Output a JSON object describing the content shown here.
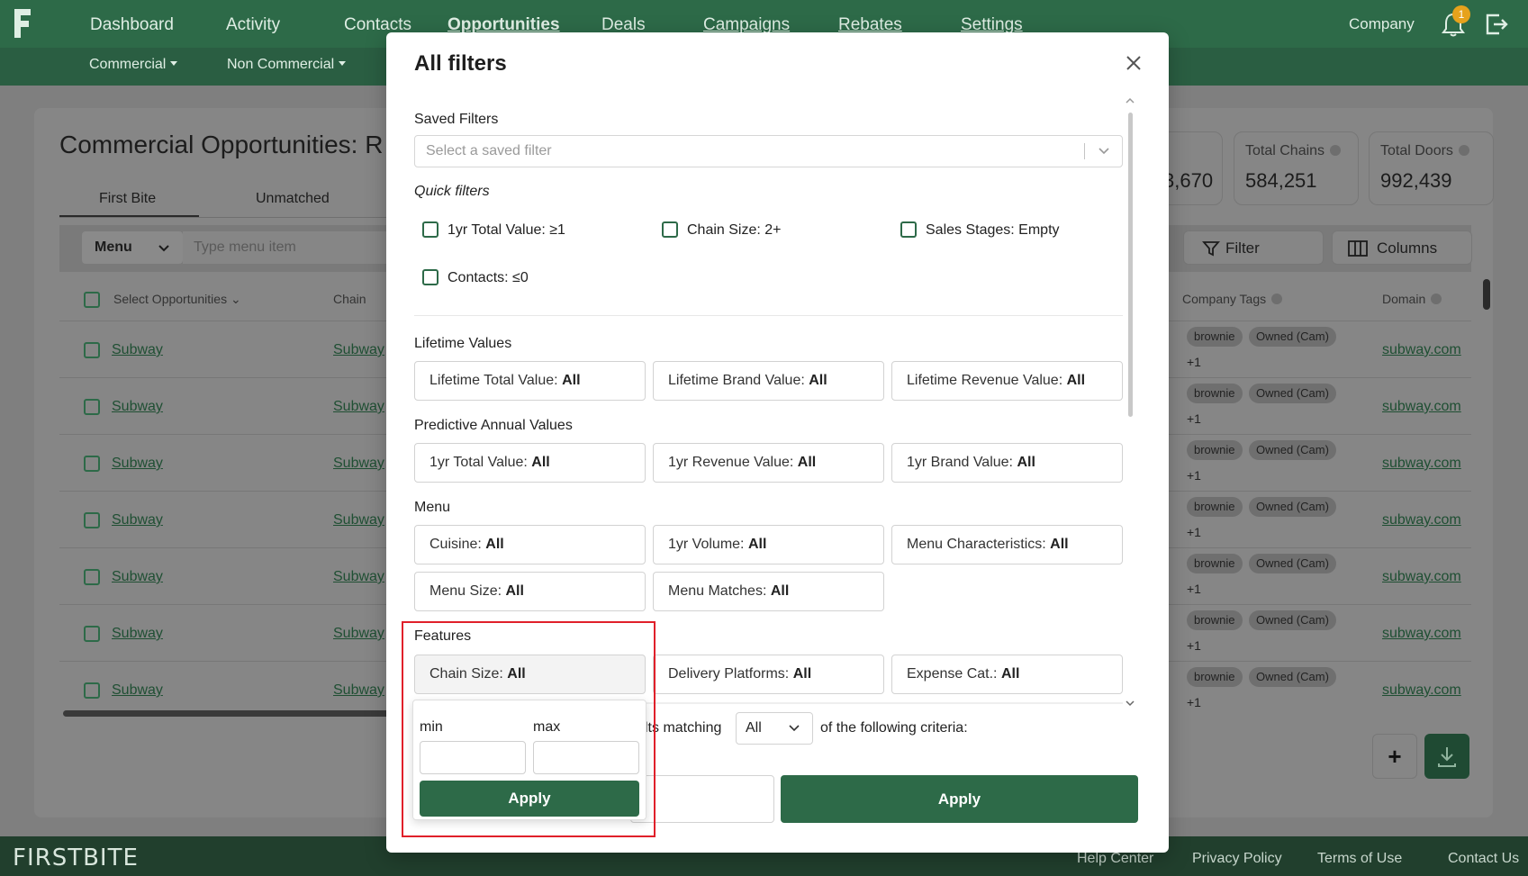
{
  "nav": {
    "items": [
      "Dashboard",
      "Activity",
      "Contacts",
      "Opportunities",
      "Deals",
      "Campaigns",
      "Rebates",
      "Settings"
    ],
    "company": "Company",
    "notification_count": "1",
    "sub_items": [
      "Commercial",
      "Non Commercial"
    ]
  },
  "page": {
    "title": "Commercial Opportunities: R",
    "tabs": [
      "First Bite",
      "Unmatched"
    ],
    "menu_select": "Menu",
    "menu_placeholder": "Type menu item",
    "stats": [
      {
        "label": "",
        "value": "3,670"
      },
      {
        "label": "Total Chains",
        "value": "584,251"
      },
      {
        "label": "Total Doors",
        "value": "992,439"
      }
    ],
    "filter_label": "Filter",
    "columns_label": "Columns",
    "table": {
      "headers": [
        "Select Opportunities",
        "Chain",
        "Company Tags",
        "Domain"
      ],
      "rows": [
        {
          "name": "Subway",
          "chain": "Subway",
          "tags": [
            "brownie",
            "Owned (Cam)"
          ],
          "more": "+1",
          "domain": "subway.com"
        },
        {
          "name": "Subway",
          "chain": "Subway",
          "tags": [
            "brownie",
            "Owned (Cam)"
          ],
          "more": "+1",
          "domain": "subway.com"
        },
        {
          "name": "Subway",
          "chain": "Subway",
          "tags": [
            "brownie",
            "Owned (Cam)"
          ],
          "more": "+1",
          "domain": "subway.com"
        },
        {
          "name": "Subway",
          "chain": "Subway",
          "tags": [
            "brownie",
            "Owned (Cam)"
          ],
          "more": "+1",
          "domain": "subway.com"
        },
        {
          "name": "Subway",
          "chain": "Subway",
          "tags": [
            "brownie",
            "Owned (Cam)"
          ],
          "more": "+1",
          "domain": "subway.com"
        },
        {
          "name": "Subway",
          "chain": "Subway",
          "tags": [
            "brownie",
            "Owned (Cam)"
          ],
          "more": "+1",
          "domain": "subway.com"
        },
        {
          "name": "Subway",
          "chain": "Subway",
          "tags": [
            "brownie",
            "Owned (Cam)"
          ],
          "more": "+1",
          "domain": "subway.com"
        }
      ]
    },
    "fab_plus": "+"
  },
  "footer": {
    "brand": "FIRSTBITE",
    "links": [
      "Help Center",
      "Privacy Policy",
      "Terms of Use",
      "Contact Us"
    ]
  },
  "modal": {
    "title": "All filters",
    "saved_filters": {
      "label": "Saved Filters",
      "placeholder": "Select a saved filter"
    },
    "quick_filters": {
      "label": "Quick filters",
      "items": [
        "1yr Total Value: ≥1",
        "Chain Size: 2+",
        "Sales Stages: Empty",
        "Contacts: ≤0"
      ]
    },
    "sections": [
      {
        "label": "Lifetime Values",
        "filters": [
          {
            "name": "Lifetime Total Value:",
            "value": "All"
          },
          {
            "name": "Lifetime Brand Value:",
            "value": "All"
          },
          {
            "name": "Lifetime Revenue Value:",
            "value": "All"
          }
        ]
      },
      {
        "label": "Predictive Annual Values",
        "filters": [
          {
            "name": "1yr Total Value:",
            "value": "All"
          },
          {
            "name": "1yr Revenue Value:",
            "value": "All"
          },
          {
            "name": "1yr Brand Value:",
            "value": "All"
          }
        ]
      },
      {
        "label": "Menu",
        "filters": [
          {
            "name": "Cuisine:",
            "value": "All"
          },
          {
            "name": "1yr Volume:",
            "value": "All"
          },
          {
            "name": "Menu Characteristics:",
            "value": "All"
          },
          {
            "name": "Menu Size:",
            "value": "All"
          },
          {
            "name": "Menu Matches:",
            "value": "All"
          }
        ]
      },
      {
        "label": "Features",
        "filters": [
          {
            "name": "Chain Size:",
            "value": "All"
          },
          {
            "name": "Delivery Platforms:",
            "value": "All"
          },
          {
            "name": "Expense Cat.:",
            "value": "All"
          }
        ]
      }
    ],
    "match": {
      "prefix": "lts matching",
      "value": "All",
      "suffix": "of the following criteria:"
    },
    "apply_label": "Apply",
    "popover": {
      "min_label": "min",
      "max_label": "max",
      "min_value": "",
      "max_value": "",
      "apply_label": "Apply"
    }
  },
  "colors": {
    "brand_green": "#2d6a48",
    "highlight_red": "#e0202a",
    "badge_orange": "#e6a21c"
  }
}
